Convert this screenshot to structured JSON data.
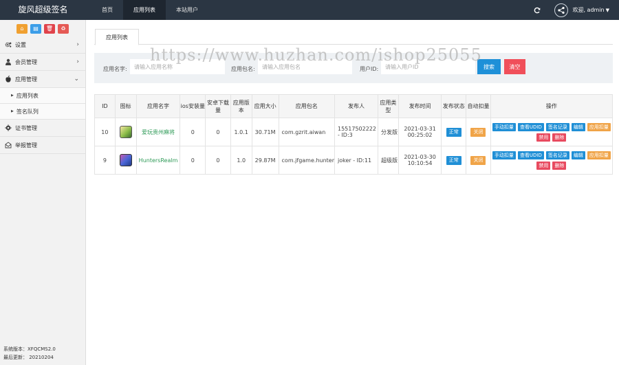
{
  "brand": "旋风超级签名",
  "nav": [
    "首页",
    "应用列表",
    "本站用户"
  ],
  "nav_active": 1,
  "user": {
    "label": "欢迎, admin"
  },
  "sidebar": {
    "quick_buttons": [
      "home-icon",
      "file-icon",
      "trash-icon",
      "recycle-icon"
    ],
    "items": [
      {
        "label": "设置",
        "icon": "gear-icon"
      },
      {
        "label": "会员管理",
        "icon": "user-icon"
      },
      {
        "label": "应用管理",
        "icon": "apple-icon"
      },
      {
        "label": "证书管理",
        "icon": "cert-icon"
      },
      {
        "label": "举报管理",
        "icon": "mail-icon"
      }
    ],
    "sub_items": [
      "应用列表",
      "签名队列"
    ],
    "footer": {
      "version": "系统版本：XFQCMS2.0",
      "updated": "最后更新： 20210204"
    }
  },
  "tab": "应用列表",
  "search": {
    "app_name_label": "应用名字:",
    "app_name_placeholder": "请输入应用名称",
    "package_label": "应用包名:",
    "package_placeholder": "请输入应用包名",
    "user_id_label": "用户ID:",
    "user_id_placeholder": "请输入用户ID",
    "search_button": "搜索",
    "clear_button": "清空"
  },
  "table": {
    "headers": [
      "ID",
      "图标",
      "应用名字",
      "ios安装量",
      "安卓下载量",
      "应用版本",
      "应用大小",
      "应用包名",
      "发布人",
      "应用类型",
      "发布时间",
      "发布状态",
      "自动扣量",
      "操作"
    ],
    "rows": [
      {
        "id": "10",
        "name": "爱玩贵州麻将",
        "ios": "0",
        "android": "0",
        "version": "1.0.1",
        "size": "30.71M",
        "package": "com.gzrit.aiwan",
        "publisher": "15517502222 - ID:3",
        "type": "分发版",
        "time": "2021-03-31 00:25:02",
        "status": "正常",
        "auto": "关闭",
        "ops": [
          "手动扣量",
          "查看UDID",
          "签名记录",
          "编辑",
          "应用扣量",
          "禁用",
          "删除"
        ]
      },
      {
        "id": "9",
        "name": "HuntersRealm",
        "ios": "0",
        "android": "0",
        "version": "1.0",
        "size": "29.87M",
        "package": "com.jfgame.hunter",
        "publisher": "joker - ID:11",
        "type": "超级版",
        "time": "2021-03-30 10:10:54",
        "status": "正常",
        "auto": "关闭",
        "ops": [
          "手动扣量",
          "查看UDID",
          "签名记录",
          "编辑",
          "应用扣量",
          "禁用",
          "删除"
        ]
      }
    ]
  },
  "watermark": "https://www.huzhan.com/ishop25055",
  "colors": {
    "topbar": "#2b3643",
    "primary": "#1e90d8",
    "danger": "#f04f5a",
    "warning": "#f0a448",
    "app_name": "#2e9a57"
  }
}
